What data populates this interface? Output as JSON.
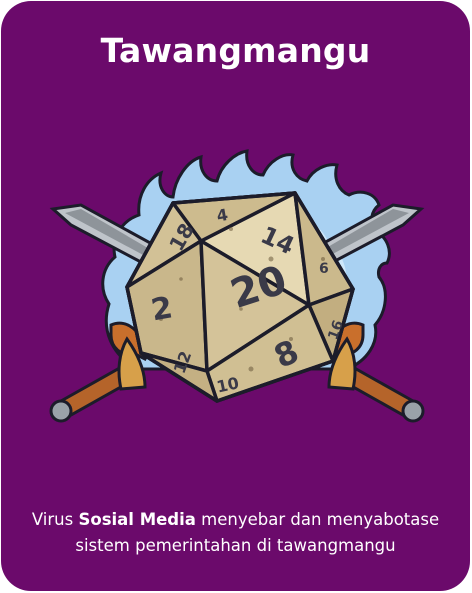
{
  "card": {
    "title": "Tawangmangu",
    "description": {
      "prefix": "Virus ",
      "highlight": "Sosial Media",
      "line1_suffix": " menyebar dan menyabotase",
      "line2": "sistem pemerintahan di tawangmangu"
    },
    "artwork_icon": "d20-dice-crossed-swords-icon",
    "dice_numbers": {
      "center": "20",
      "top": "4",
      "top_left": "18",
      "top_right": "14",
      "left": "2",
      "right_small": "6",
      "bottom_right": "8",
      "right_side": "16",
      "bottom_left": "12",
      "bottom": "10"
    }
  },
  "colors": {
    "card_background": "#6b0a6b",
    "text": "#ffffff",
    "dice_face": "#d9c9a0",
    "flame": "#9ec9ee",
    "blade": "#b9bec4",
    "hilt": "#c86f2c"
  }
}
